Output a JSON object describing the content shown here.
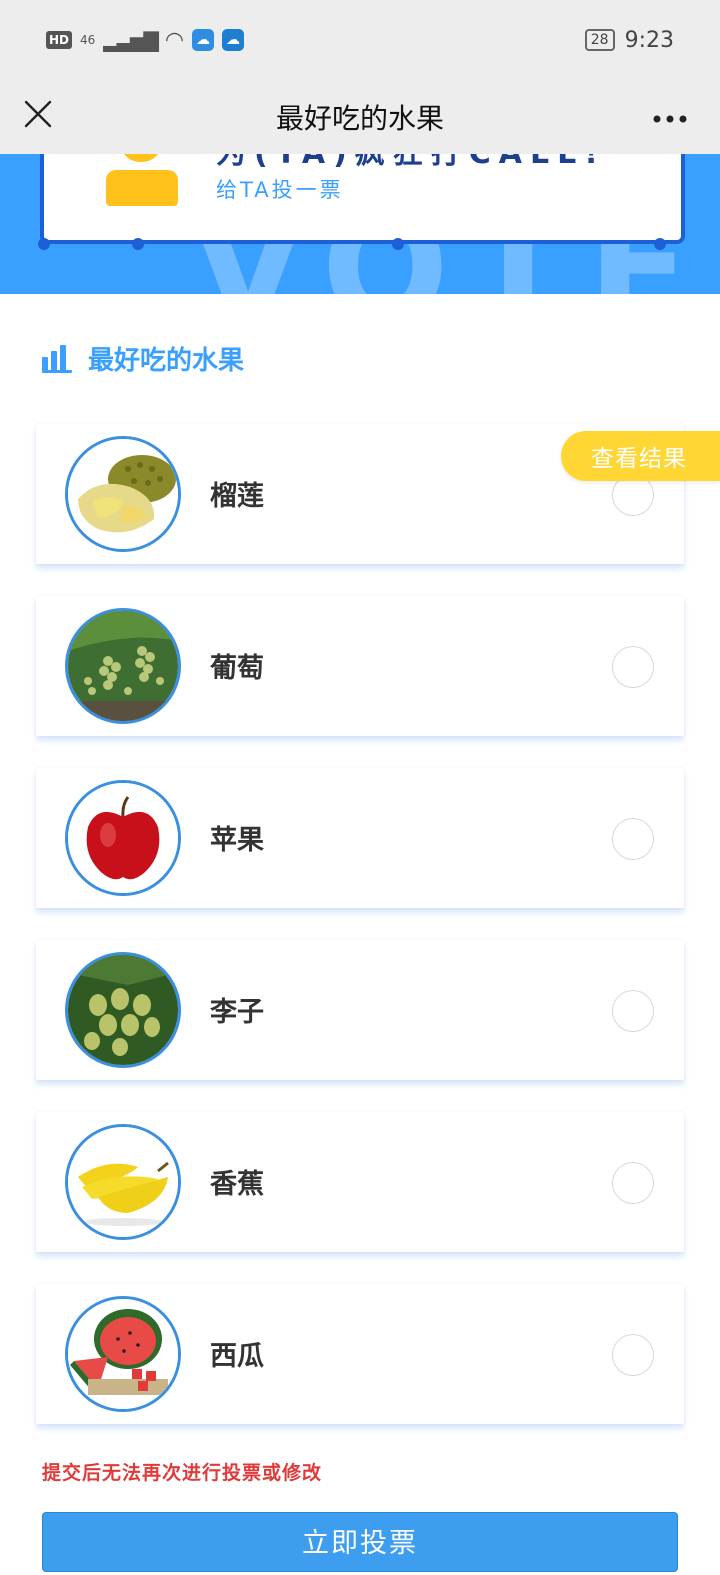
{
  "status_bar": {
    "hd": "HD",
    "network": "46",
    "battery": "28",
    "time": "9:23"
  },
  "nav": {
    "title": "最好吃的水果",
    "close": "✕",
    "more": "•••"
  },
  "banner": {
    "headline_cut": "为(TA)疯狂打CALL!",
    "subtitle": "给TA投一票",
    "watermark": "VOTE"
  },
  "section": {
    "title": "最好吃的水果"
  },
  "view_results_label": "查看结果",
  "options": [
    {
      "name": "榴莲",
      "icon": "durian-image"
    },
    {
      "name": "葡萄",
      "icon": "grape-image"
    },
    {
      "name": "苹果",
      "icon": "apple-image"
    },
    {
      "name": "李子",
      "icon": "plum-image"
    },
    {
      "name": "香蕉",
      "icon": "banana-image"
    },
    {
      "name": "西瓜",
      "icon": "watermelon-image"
    }
  ],
  "notice": "提交后无法再次进行投票或修改",
  "submit_label": "立即投票",
  "colors": {
    "accent": "#3aa0ff",
    "banner_dark": "#1c5fd6",
    "yellow": "#ffd633",
    "warning": "#e03b3b"
  }
}
